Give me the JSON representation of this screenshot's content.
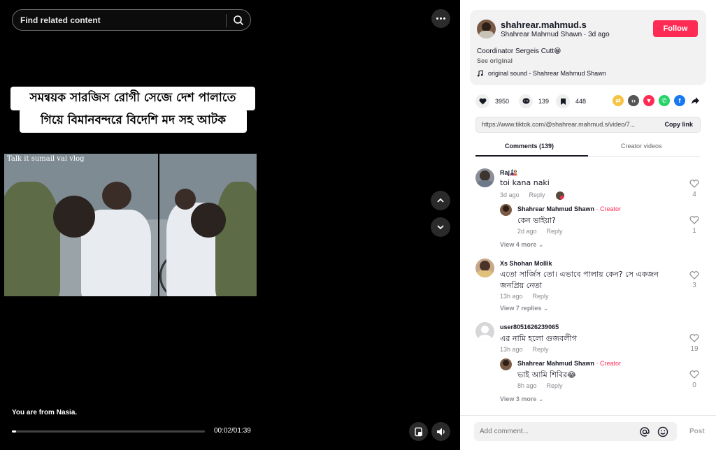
{
  "search": {
    "placeholder": "Find related content"
  },
  "video": {
    "caption_line1": "সমন্বয়ক সারজিস রোগী সেজে দেশ পালাতে",
    "caption_line2": "গিয়ে বিমানবন্দরে বিদেশি মদ সহ আটক",
    "overlay_tag": "Talk it sumail vai vlog",
    "bottom_text": "You are from Nasia.",
    "time": "00:02/01:39",
    "progress": 0.02
  },
  "author": {
    "username": "shahrear.mahmud.s",
    "display_name": "Shahrear Mahmud Shawn",
    "posted": "3d ago",
    "follow_label": "Follow",
    "description": "Coordinator Sergeis Cutt😁",
    "see_original": "See original",
    "sound": "original sound - Shahrear Mahmud Shawn"
  },
  "stats": {
    "likes": "3950",
    "comments": "139",
    "saves": "448"
  },
  "link": {
    "url": "https://www.tiktok.com/@shahrear.mahmud.s/video/7...",
    "copy_label": "Copy link"
  },
  "tabs": {
    "comments": "Comments (139)",
    "creator_videos": "Creator videos"
  },
  "comments": [
    {
      "name": "Raj🎎",
      "text": "toi kana naki",
      "time": "3d ago",
      "reply": "Reply",
      "likes": "4"
    },
    {
      "name": "Shahrear Mahmud Shawn",
      "creator": "· Creator",
      "text": "কেন ভাইয়া?",
      "time": "2d ago",
      "reply": "Reply",
      "likes": "1"
    },
    {
      "view_more": "View 4 more"
    },
    {
      "name": "Xs Shohan Mollik",
      "text1": "এতো সার্জিস তো। এভাবে পালায় কেন? সে একজন",
      "text2": "জনপ্রিয় নেতা",
      "time": "13h ago",
      "reply": "Reply",
      "likes": "3"
    },
    {
      "view_more": "View 7 replies"
    },
    {
      "name": "user8051626239065",
      "text": "এর নামি হলো গুজবলীগ",
      "time": "13h ago",
      "reply": "Reply",
      "likes": "19"
    },
    {
      "name": "Shahrear Mahmud Shawn",
      "creator": "· Creator",
      "text": "ভাই আমি শিবির😂",
      "time": "8h ago",
      "reply": "Reply",
      "likes": "0"
    },
    {
      "view_more": "View 3 more"
    }
  ],
  "comment_bar": {
    "placeholder": "Add comment...",
    "post_label": "Post"
  },
  "colors": {
    "accent": "#fe2c55",
    "video_bg": "#000000"
  }
}
